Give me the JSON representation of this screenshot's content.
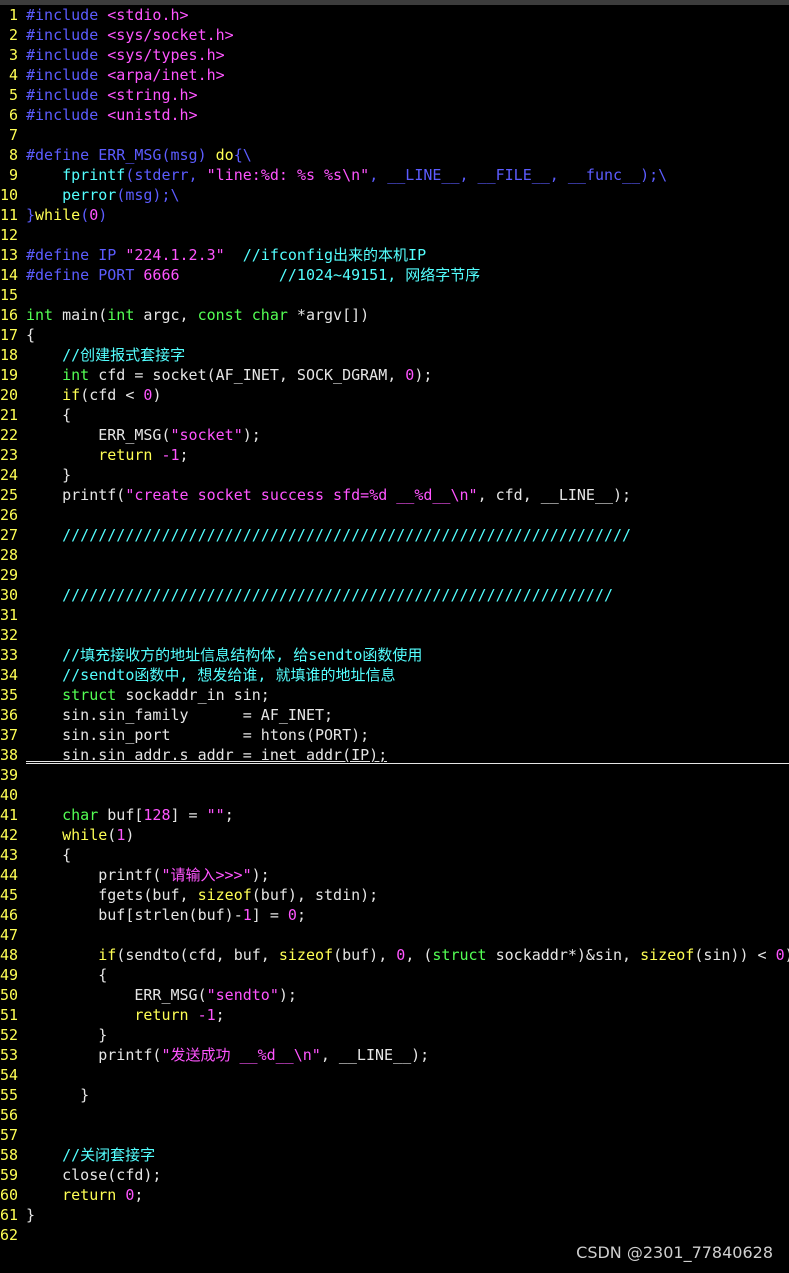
{
  "colors": {
    "background": "#000000",
    "line_number": "#ffff54",
    "default": "#e5e5e5",
    "preprocessor": "#5c5cff",
    "preproc_value": "#ff55ff",
    "keyword": "#ffff54",
    "type": "#54ff54",
    "string": "#ff55ff",
    "number": "#ff55ff",
    "comment": "#54ffff",
    "function": "#54ffff"
  },
  "editor": {
    "cursor_line": 38,
    "lines": [
      {
        "n": "1",
        "tokens": [
          [
            "pp",
            "#include "
          ],
          [
            "ppv",
            "<stdio.h>"
          ]
        ]
      },
      {
        "n": "2",
        "tokens": [
          [
            "pp",
            "#include "
          ],
          [
            "ppv",
            "<sys/socket.h>"
          ]
        ]
      },
      {
        "n": "3",
        "tokens": [
          [
            "pp",
            "#include "
          ],
          [
            "ppv",
            "<sys/types.h>"
          ]
        ]
      },
      {
        "n": "4",
        "tokens": [
          [
            "pp",
            "#include "
          ],
          [
            "ppv",
            "<arpa/inet.h>"
          ]
        ]
      },
      {
        "n": "5",
        "tokens": [
          [
            "pp",
            "#include "
          ],
          [
            "ppv",
            "<string.h>"
          ]
        ]
      },
      {
        "n": "6",
        "tokens": [
          [
            "pp",
            "#include "
          ],
          [
            "ppv",
            "<unistd.h>"
          ]
        ]
      },
      {
        "n": "7",
        "tokens": []
      },
      {
        "n": "8",
        "tokens": [
          [
            "pp",
            "#define ERR_MSG(msg) "
          ],
          [
            "kw",
            "do"
          ],
          [
            "pp",
            "{\\"
          ]
        ]
      },
      {
        "n": "9",
        "tokens": [
          [
            "default",
            "    "
          ],
          [
            "fn",
            "fprintf"
          ],
          [
            "pp",
            "(stderr, "
          ],
          [
            "str",
            "\"line:"
          ],
          [
            "ppv",
            "%d"
          ],
          [
            "str",
            ": "
          ],
          [
            "ppv",
            "%s %s"
          ],
          [
            "str",
            "\\n\""
          ],
          [
            "pp",
            ", __LINE__, __FILE__, __func__);\\"
          ]
        ]
      },
      {
        "n": "10",
        "tokens": [
          [
            "default",
            "    "
          ],
          [
            "fn",
            "perror"
          ],
          [
            "pp",
            "(msg);\\"
          ]
        ]
      },
      {
        "n": "11",
        "tokens": [
          [
            "pp",
            "}"
          ],
          [
            "kw",
            "while"
          ],
          [
            "pp",
            "("
          ],
          [
            "num",
            "0"
          ],
          [
            "pp",
            ")"
          ]
        ]
      },
      {
        "n": "12",
        "tokens": []
      },
      {
        "n": "13",
        "tokens": [
          [
            "pp",
            "#define IP "
          ],
          [
            "str",
            "\"224.1.2.3\""
          ],
          [
            "pp",
            "  "
          ],
          [
            "com",
            "//ifconfig出来的本机IP"
          ]
        ]
      },
      {
        "n": "14",
        "tokens": [
          [
            "pp",
            "#define PORT "
          ],
          [
            "num",
            "6666"
          ],
          [
            "pp",
            "           "
          ],
          [
            "com",
            "//1024~49151, 网络字节序"
          ]
        ]
      },
      {
        "n": "15",
        "tokens": []
      },
      {
        "n": "16",
        "tokens": [
          [
            "type",
            "int"
          ],
          [
            "default",
            " main("
          ],
          [
            "type",
            "int"
          ],
          [
            "default",
            " argc, "
          ],
          [
            "type",
            "const"
          ],
          [
            "default",
            " "
          ],
          [
            "type",
            "char"
          ],
          [
            "default",
            " *argv[])"
          ]
        ]
      },
      {
        "n": "17",
        "tokens": [
          [
            "default",
            "{"
          ]
        ]
      },
      {
        "n": "18",
        "tokens": [
          [
            "default",
            "    "
          ],
          [
            "com",
            "//创建报式套接字"
          ]
        ]
      },
      {
        "n": "19",
        "tokens": [
          [
            "default",
            "    "
          ],
          [
            "type",
            "int"
          ],
          [
            "default",
            " cfd = socket(AF_INET, SOCK_DGRAM, "
          ],
          [
            "num",
            "0"
          ],
          [
            "default",
            ");"
          ]
        ]
      },
      {
        "n": "20",
        "tokens": [
          [
            "default",
            "    "
          ],
          [
            "kw",
            "if"
          ],
          [
            "default",
            "(cfd < "
          ],
          [
            "num",
            "0"
          ],
          [
            "default",
            ")"
          ]
        ]
      },
      {
        "n": "21",
        "tokens": [
          [
            "default",
            "    {"
          ]
        ]
      },
      {
        "n": "22",
        "tokens": [
          [
            "default",
            "        ERR_MSG("
          ],
          [
            "str",
            "\"socket\""
          ],
          [
            "default",
            ");"
          ]
        ]
      },
      {
        "n": "23",
        "tokens": [
          [
            "default",
            "        "
          ],
          [
            "kw",
            "return"
          ],
          [
            "default",
            " "
          ],
          [
            "num",
            "-1"
          ],
          [
            "default",
            ";"
          ]
        ]
      },
      {
        "n": "24",
        "tokens": [
          [
            "default",
            "    }"
          ]
        ]
      },
      {
        "n": "25",
        "tokens": [
          [
            "default",
            "    printf("
          ],
          [
            "str",
            "\"create socket success sfd="
          ],
          [
            "ppv",
            "%d"
          ],
          [
            "str",
            " __"
          ],
          [
            "ppv",
            "%d"
          ],
          [
            "str",
            "__"
          ],
          [
            "ppv",
            "\\n"
          ],
          [
            "str",
            "\""
          ],
          [
            "default",
            ", cfd, __LINE__);"
          ]
        ]
      },
      {
        "n": "26",
        "tokens": []
      },
      {
        "n": "27",
        "tokens": [
          [
            "default",
            "    "
          ],
          [
            "com",
            "///////////////////////////////////////////////////////////////"
          ]
        ]
      },
      {
        "n": "28",
        "tokens": []
      },
      {
        "n": "29",
        "tokens": []
      },
      {
        "n": "30",
        "tokens": [
          [
            "default",
            "    "
          ],
          [
            "com",
            "/////////////////////////////////////////////////////////////"
          ]
        ]
      },
      {
        "n": "31",
        "tokens": []
      },
      {
        "n": "32",
        "tokens": []
      },
      {
        "n": "33",
        "tokens": [
          [
            "default",
            "    "
          ],
          [
            "com",
            "//填充接收方的地址信息结构体, 给sendto函数使用"
          ]
        ]
      },
      {
        "n": "34",
        "tokens": [
          [
            "default",
            "    "
          ],
          [
            "com",
            "//sendto函数中, 想发给谁, 就填谁的地址信息"
          ]
        ]
      },
      {
        "n": "35",
        "tokens": [
          [
            "default",
            "    "
          ],
          [
            "type",
            "struct"
          ],
          [
            "default",
            " sockaddr_in sin;"
          ]
        ]
      },
      {
        "n": "36",
        "tokens": [
          [
            "default",
            "    sin.sin_family      = AF_INET;"
          ]
        ]
      },
      {
        "n": "37",
        "tokens": [
          [
            "default",
            "    sin.sin_port        = htons(PORT);"
          ]
        ]
      },
      {
        "n": "38",
        "tokens": [
          [
            "default",
            "    sin.sin_addr.s_addr = inet_addr(IP);"
          ]
        ]
      },
      {
        "n": "39",
        "tokens": []
      },
      {
        "n": "40",
        "tokens": []
      },
      {
        "n": "41",
        "tokens": [
          [
            "default",
            "    "
          ],
          [
            "type",
            "char"
          ],
          [
            "default",
            " buf["
          ],
          [
            "num",
            "128"
          ],
          [
            "default",
            "] = "
          ],
          [
            "str",
            "\"\""
          ],
          [
            "default",
            ";"
          ]
        ]
      },
      {
        "n": "42",
        "tokens": [
          [
            "default",
            "    "
          ],
          [
            "kw",
            "while"
          ],
          [
            "default",
            "("
          ],
          [
            "num",
            "1"
          ],
          [
            "default",
            ")"
          ]
        ]
      },
      {
        "n": "43",
        "tokens": [
          [
            "default",
            "    {"
          ]
        ]
      },
      {
        "n": "44",
        "tokens": [
          [
            "default",
            "        printf("
          ],
          [
            "str",
            "\"请输入>>>\""
          ],
          [
            "default",
            ");"
          ]
        ]
      },
      {
        "n": "45",
        "tokens": [
          [
            "default",
            "        fgets(buf, "
          ],
          [
            "kw",
            "sizeof"
          ],
          [
            "default",
            "(buf), stdin);"
          ]
        ]
      },
      {
        "n": "46",
        "tokens": [
          [
            "default",
            "        buf[strlen(buf)-"
          ],
          [
            "num",
            "1"
          ],
          [
            "default",
            "] = "
          ],
          [
            "num",
            "0"
          ],
          [
            "default",
            ";"
          ]
        ]
      },
      {
        "n": "47",
        "tokens": []
      },
      {
        "n": "48",
        "tokens": [
          [
            "default",
            "        "
          ],
          [
            "kw",
            "if"
          ],
          [
            "default",
            "(sendto(cfd, buf, "
          ],
          [
            "kw",
            "sizeof"
          ],
          [
            "default",
            "(buf), "
          ],
          [
            "num",
            "0"
          ],
          [
            "default",
            ", ("
          ],
          [
            "type",
            "struct"
          ],
          [
            "default",
            " sockaddr*)&sin, "
          ],
          [
            "kw",
            "sizeof"
          ],
          [
            "default",
            "(sin)) < "
          ],
          [
            "num",
            "0"
          ],
          [
            "default",
            ")"
          ]
        ]
      },
      {
        "n": "49",
        "tokens": [
          [
            "default",
            "        {"
          ]
        ]
      },
      {
        "n": "50",
        "tokens": [
          [
            "default",
            "            ERR_MSG("
          ],
          [
            "str",
            "\"sendto\""
          ],
          [
            "default",
            ");"
          ]
        ]
      },
      {
        "n": "51",
        "tokens": [
          [
            "default",
            "            "
          ],
          [
            "kw",
            "return"
          ],
          [
            "default",
            " "
          ],
          [
            "num",
            "-1"
          ],
          [
            "default",
            ";"
          ]
        ]
      },
      {
        "n": "52",
        "tokens": [
          [
            "default",
            "        }"
          ]
        ]
      },
      {
        "n": "53",
        "tokens": [
          [
            "default",
            "        printf("
          ],
          [
            "str",
            "\"发送成功 __"
          ],
          [
            "ppv",
            "%d"
          ],
          [
            "str",
            "__"
          ],
          [
            "ppv",
            "\\n"
          ],
          [
            "str",
            "\""
          ],
          [
            "default",
            ", __LINE__);"
          ]
        ]
      },
      {
        "n": "54",
        "tokens": []
      },
      {
        "n": "55",
        "tokens": [
          [
            "default",
            "      }"
          ]
        ]
      },
      {
        "n": "56",
        "tokens": []
      },
      {
        "n": "57",
        "tokens": []
      },
      {
        "n": "58",
        "tokens": [
          [
            "default",
            "    "
          ],
          [
            "com",
            "//关闭套接字"
          ]
        ]
      },
      {
        "n": "59",
        "tokens": [
          [
            "default",
            "    close(cfd);"
          ]
        ]
      },
      {
        "n": "60",
        "tokens": [
          [
            "default",
            "    "
          ],
          [
            "kw",
            "return"
          ],
          [
            "default",
            " "
          ],
          [
            "num",
            "0"
          ],
          [
            "default",
            ";"
          ]
        ]
      },
      {
        "n": "61",
        "tokens": [
          [
            "default",
            "}"
          ]
        ]
      },
      {
        "n": "62",
        "tokens": []
      }
    ]
  },
  "watermark": {
    "text": "CSDN @2301_77840628"
  }
}
